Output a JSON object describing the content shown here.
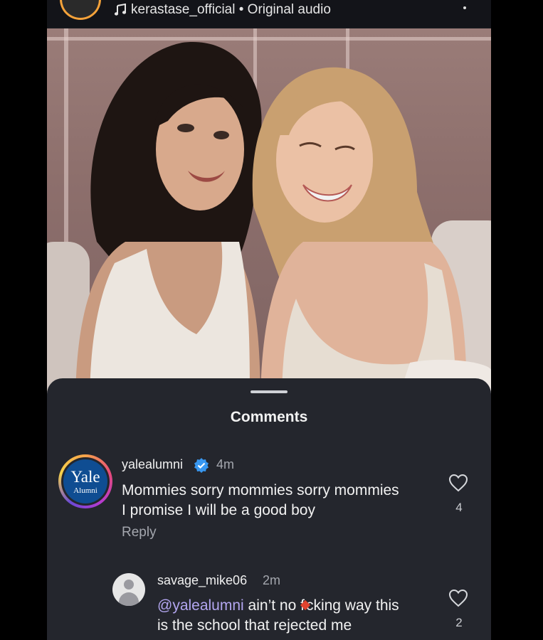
{
  "audio": {
    "text": "kerastase_official • Original audio",
    "icon": "music-note-icon"
  },
  "sheet": {
    "title": "Comments"
  },
  "comments": [
    {
      "username": "yalealumni",
      "verified": true,
      "time": "4m",
      "text_line1": "Mommies sorry mommies sorry mommies",
      "text_line2": "I promise I will be a good boy",
      "reply_label": "Reply",
      "likes": "4",
      "avatar": {
        "word": "Yale",
        "sub": "Alumni",
        "color": "#0f4d92"
      }
    },
    {
      "username": "savage_mike06",
      "verified": false,
      "time": "2m",
      "mention": "@yalealumni",
      "text_line1_a": " ain’t no f",
      "text_line1_b": "cking way this",
      "text_line2": "is the school that rejected me",
      "likes": "2"
    }
  ],
  "colors": {
    "sheet_bg": "#24262d",
    "mention": "#b3a6f0",
    "verified": "#3897f0"
  }
}
